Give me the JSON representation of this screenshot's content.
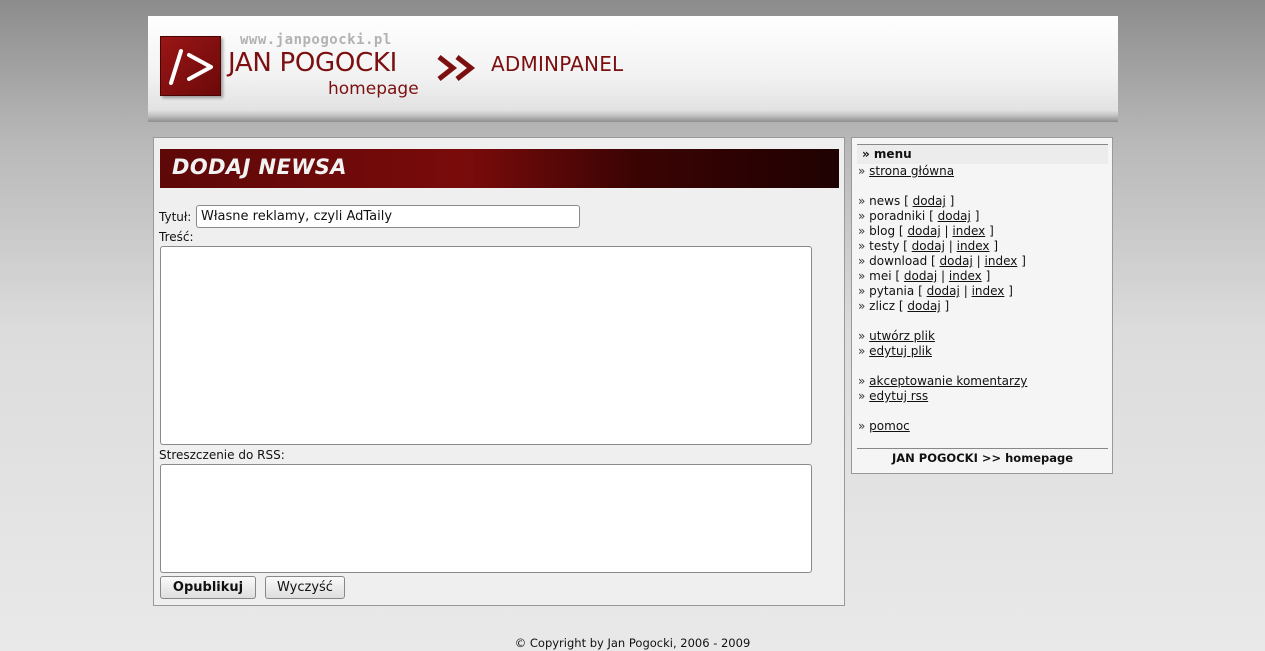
{
  "header": {
    "site_url": "www.janpogocki.pl",
    "site_name": "JAN POGOCKI",
    "site_sub": "homepage",
    "admin_title": "ADMINPANEL",
    "logo_icon": "slash-arrow-logo-icon",
    "arrows_icon": "double-chevron-right-icon",
    "brand_color": "#7c0f0f"
  },
  "form": {
    "section_title": "DODAJ NEWSA",
    "title_label": "Tytuł:",
    "title_value": "Własne reklamy, czyli AdTaily",
    "content_label": "Treść:",
    "content_value": "",
    "summary_label": "Streszczenie do RSS:",
    "summary_value": "",
    "publish_label": "Opublikuj",
    "clear_label": "Wyczyść"
  },
  "menu": {
    "header": "» menu",
    "bullet": "»",
    "home": "strona główna",
    "news": "news",
    "guides": "poradniki",
    "blog": "blog",
    "tests": "testy",
    "download": "download",
    "mei": "mei",
    "questions": "pytania",
    "counter": "zlicz",
    "add": "dodaj",
    "index": "index",
    "bracket_open": "[",
    "bracket_close": "]",
    "separator": "|",
    "create_file": "utwórz plik",
    "edit_file": "edytuj plik",
    "accept_comments": "akceptowanie komentarzy",
    "edit_rss": "edytuj rss",
    "help": "pomoc",
    "footer": "JAN POGOCKI >> homepage"
  },
  "footer": {
    "copyright": "© Copyright by Jan Pogocki, 2006 - 2009"
  }
}
